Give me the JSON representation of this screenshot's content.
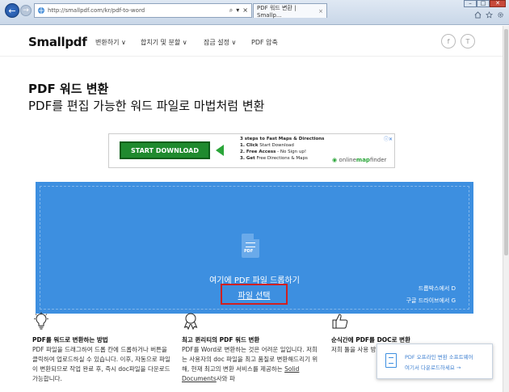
{
  "browser": {
    "back_glyph": "←",
    "forward_glyph": "→",
    "url": "http://smallpdf.com/kr/pdf-to-word",
    "address_tools": [
      "⌕",
      "▾",
      "×"
    ],
    "tab_title": "PDF 워드 변환 | Smallp...",
    "tab_close": "×",
    "window_controls": [
      "–",
      "□",
      "✕"
    ],
    "toolbar_icons": [
      "home-icon",
      "star-icon",
      "gear-icon"
    ]
  },
  "header": {
    "logo": "Smallpdf",
    "nav": [
      "변환하기 ∨",
      "합치기 및 분할 ∨",
      "잠금 설정 ∨",
      "PDF 압축"
    ],
    "social": [
      "f",
      "T"
    ]
  },
  "main": {
    "title": "PDF 워드 변환",
    "subtitle": "PDF를 편집 가능한 워드 파일로 마법처럼 변환"
  },
  "ad": {
    "button": "START DOWNLOAD",
    "headline": "3 steps to Fast Maps & Directions",
    "step1_bold": "1. Click",
    "step1": " Start Download",
    "step2_bold": "2. Free Access",
    "step2": " - No Sign up!",
    "step3_bold": "3. Get",
    "step3": " Free Directions & Maps",
    "brand_prefix": "online",
    "brand_accent": "map",
    "brand_suffix": "finder",
    "adchoice": "ⓘ✕"
  },
  "dropzone": {
    "icon_label": "PDF",
    "drop_text": "여기에 PDF 파일 드롭하기",
    "choose_file": "파일 선택",
    "dropbox": "드롭박스에서 D",
    "gdrive": "구글 드라이브에서 G",
    "bg_color": "#3d8fe0",
    "highlight_color": "#d02020"
  },
  "features": [
    {
      "icon": "lightbulb-icon",
      "heading": "PDF를 워드로 변환하는 방법",
      "text": "PDF 파일을 드래그하여 드롭 칸에 드롭하거나 버튼을 클릭하여 업로드하실 수 있습니다. 이후, 자동으로 파일이 변환되므로 작업 완료 후, 즉시 doc파일을 다운로드 가능합니다."
    },
    {
      "icon": "award-icon",
      "heading": "최고 퀸리티의 PDF 워드 변환",
      "text_a": "PDF를 Word로 변환하는 것은 어려운 일입니다. 저희는 사용자의 doc 파일을 최고 품질로 변환해드리기 위해, 현재 최고의 변환 서비스를 제공하는 ",
      "link": "Solid Documents",
      "text_b": "사와 파"
    },
    {
      "icon": "thumbs-up-icon",
      "heading": "순식간에 PDF를 DOC로 변환",
      "text": "저희 툴을 사용 방법이 아주 쉬 입니다. 써보"
    }
  ],
  "popup": {
    "line1": "PDF 오프라인 변환 소프트웨어",
    "line2": "여기서 다운로드하세요 →"
  }
}
